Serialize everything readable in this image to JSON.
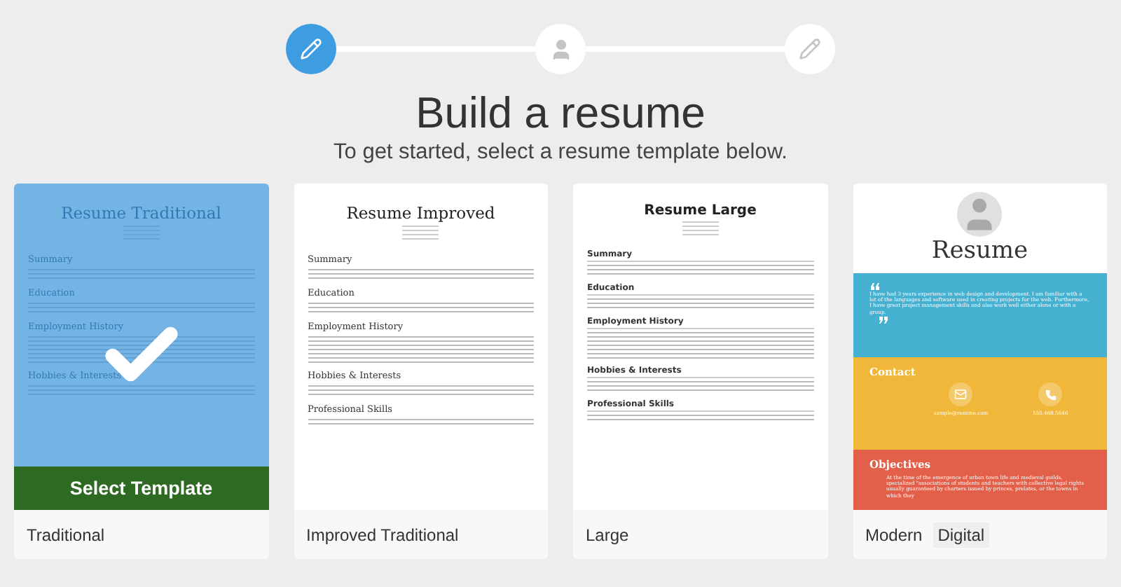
{
  "steps": [
    {
      "kind": "pencil",
      "selected": true
    },
    {
      "kind": "person",
      "selected": false
    },
    {
      "kind": "pencil",
      "selected": false
    }
  ],
  "title": "Build a resume",
  "subtitle": "To get started, select a resume template below.",
  "select_button": "Select Template",
  "templates": [
    {
      "kind": "traditional",
      "selected": true,
      "labels": [
        "Traditional"
      ],
      "preview": {
        "title": "Resume Traditional",
        "sections": [
          "Summary",
          "Education",
          "Employment History",
          "Hobbies & Interests"
        ]
      }
    },
    {
      "kind": "improved",
      "selected": false,
      "labels": [
        "Improved Traditional"
      ],
      "preview": {
        "title": "Resume Improved",
        "sections": [
          "Summary",
          "Education",
          "Employment History",
          "Hobbies & Interests",
          "Professional Skills"
        ]
      }
    },
    {
      "kind": "large",
      "selected": false,
      "labels": [
        "Large"
      ],
      "preview": {
        "title": "Resume Large",
        "sections": [
          "Summary",
          "Education",
          "Employment History",
          "Hobbies & Interests",
          "Professional Skills"
        ]
      }
    },
    {
      "kind": "modern",
      "selected": false,
      "labels": [
        "Modern",
        "Digital"
      ],
      "preview": {
        "title": "Resume",
        "quote": "I have had 3 years experience in web design and development. I am familiar with a lot of the languages and software used in creating projects for the web. Furthermore, I have great project management skills and also work well either alone or with a group.",
        "contact_heading": "Contact",
        "email": "sample@resume.com",
        "phone": "555.468.5646",
        "objectives_heading": "Objectives",
        "objectives": "At the time of the emergence of urban town life and medieval guilds, specialized \"associations of students and teachers with collective legal rights usually guaranteed by charters issued by princes, prelates, or the towns in which they"
      }
    }
  ]
}
